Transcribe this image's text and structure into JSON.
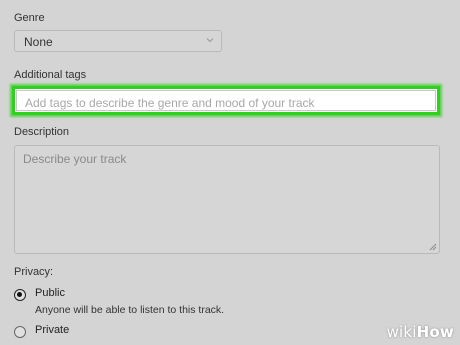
{
  "genre": {
    "label": "Genre",
    "selected": "None"
  },
  "tags": {
    "label": "Additional tags",
    "placeholder": "Add tags to describe the genre and mood of your track",
    "highlight_color": "#2fd11e"
  },
  "description": {
    "label": "Description",
    "placeholder": "Describe your track"
  },
  "privacy": {
    "label": "Privacy:",
    "options": [
      {
        "label": "Public",
        "help": "Anyone will be able to listen to this track.",
        "checked": true
      },
      {
        "label": "Private",
        "checked": false
      }
    ]
  },
  "watermark": {
    "wiki": "wiki",
    "how": "How"
  },
  "icons": {
    "select_arrow": "chevron-down-icon",
    "textarea_handle": "resize-handle-icon"
  }
}
